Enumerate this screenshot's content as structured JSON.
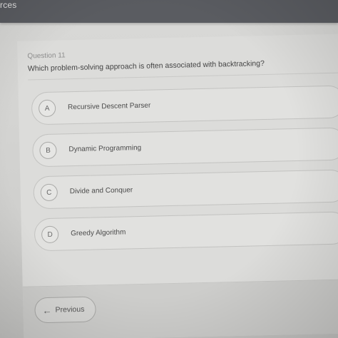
{
  "topbar": {
    "partial_title": "rces"
  },
  "question": {
    "number_label": "Question 11",
    "text": "Which problem-solving approach is often associated with backtracking?"
  },
  "options": [
    {
      "letter": "A",
      "label": "Recursive Descent Parser"
    },
    {
      "letter": "B",
      "label": "Dynamic Programming"
    },
    {
      "letter": "C",
      "label": "Divide and Conquer"
    },
    {
      "letter": "D",
      "label": "Greedy Algorithm"
    }
  ],
  "footer": {
    "previous_label": "Previous",
    "previous_icon": "arrow-left-icon"
  }
}
